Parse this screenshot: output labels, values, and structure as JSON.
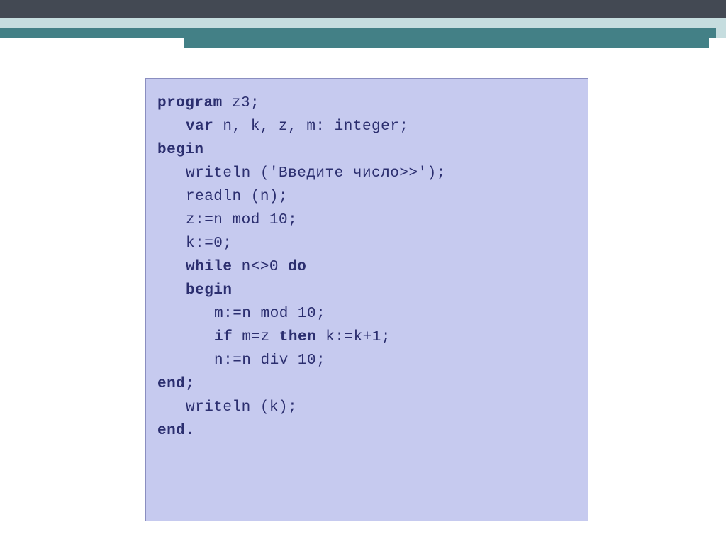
{
  "code": {
    "l1_kw": "program",
    "l1_rest": " z3;",
    "l2_kw": "var",
    "l2_rest": " n, k, z, m: integer;",
    "l3_kw": "begin",
    "l4": "writeln ('Введите число>>');",
    "l5": "readln (n);",
    "l6": "z:=n mod 10;",
    "l7": "k:=0;",
    "l8_kw": "while",
    "l8_mid": " n<>0 ",
    "l8_kw2": "do",
    "l9_kw": "begin",
    "l10": "m:=n mod 10;",
    "l11_kw": "if",
    "l11_mid": " m=z ",
    "l11_kw2": "then",
    "l11_rest": " k:=k+1;",
    "l12": "n:=n div 10;",
    "l13_kw": "end;",
    "l14": "writeln (k);",
    "l15_kw": "end."
  }
}
